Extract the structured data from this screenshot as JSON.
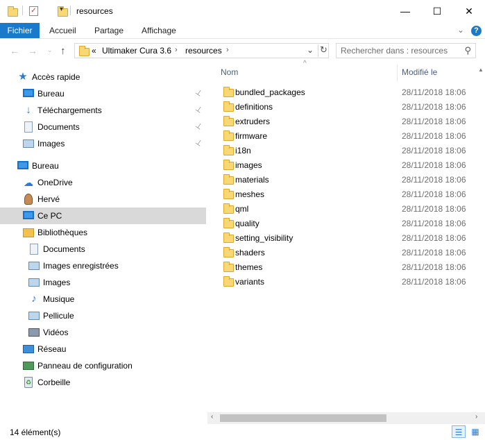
{
  "window": {
    "title": "resources",
    "minimize_glyph": "—",
    "maximize_glyph": "☐",
    "close_glyph": "✕"
  },
  "ribbon": {
    "tabs": [
      "Fichier",
      "Accueil",
      "Partage",
      "Affichage"
    ],
    "help_glyph": "?",
    "collapse_glyph": "⌄"
  },
  "address": {
    "overflow": "«",
    "segments": [
      "Ultimaker Cura 3.6",
      "resources"
    ],
    "separator": "›",
    "dropdown_glyph": "⌄",
    "refresh_glyph": "↻"
  },
  "search": {
    "placeholder": "Rechercher dans : resources",
    "icon": "search-icon"
  },
  "nav": {
    "items": [
      {
        "label": "Accès rapide",
        "icon": "star-icon",
        "indent": 0,
        "pinned": false,
        "selected": false
      },
      {
        "label": "Bureau",
        "icon": "desktop-icon",
        "indent": 1,
        "pinned": true,
        "selected": false
      },
      {
        "label": "Téléchargements",
        "icon": "download-icon",
        "indent": 1,
        "pinned": true,
        "selected": false
      },
      {
        "label": "Documents",
        "icon": "document-icon",
        "indent": 1,
        "pinned": true,
        "selected": false
      },
      {
        "label": "Images",
        "icon": "pictures-icon",
        "indent": 1,
        "pinned": true,
        "selected": false
      },
      {
        "label": "Bureau",
        "icon": "desktop-icon",
        "indent": 0,
        "pinned": false,
        "selected": false
      },
      {
        "label": "OneDrive",
        "icon": "cloud-icon",
        "indent": 1,
        "pinned": false,
        "selected": false
      },
      {
        "label": "Hervé",
        "icon": "user-icon",
        "indent": 1,
        "pinned": false,
        "selected": false
      },
      {
        "label": "Ce PC",
        "icon": "computer-icon",
        "indent": 1,
        "pinned": false,
        "selected": true
      },
      {
        "label": "Bibliothèques",
        "icon": "libraries-icon",
        "indent": 1,
        "pinned": false,
        "selected": false
      },
      {
        "label": "Documents",
        "icon": "document-icon",
        "indent": 2,
        "pinned": false,
        "selected": false
      },
      {
        "label": "Images enregistrées",
        "icon": "pictures-icon",
        "indent": 2,
        "pinned": false,
        "selected": false
      },
      {
        "label": "Images",
        "icon": "pictures-icon",
        "indent": 2,
        "pinned": false,
        "selected": false
      },
      {
        "label": "Musique",
        "icon": "music-icon",
        "indent": 2,
        "pinned": false,
        "selected": false
      },
      {
        "label": "Pellicule",
        "icon": "pictures-icon",
        "indent": 2,
        "pinned": false,
        "selected": false
      },
      {
        "label": "Vidéos",
        "icon": "video-icon",
        "indent": 2,
        "pinned": false,
        "selected": false
      },
      {
        "label": "Réseau",
        "icon": "network-icon",
        "indent": 1,
        "pinned": false,
        "selected": false
      },
      {
        "label": "Panneau de configuration",
        "icon": "control-panel-icon",
        "indent": 1,
        "pinned": false,
        "selected": false
      },
      {
        "label": "Corbeille",
        "icon": "recycle-bin-icon",
        "indent": 1,
        "pinned": false,
        "selected": false
      }
    ],
    "pin_glyph": "📌"
  },
  "columns": {
    "name": "Nom",
    "modified": "Modifié le",
    "sort_glyph": "^"
  },
  "files": [
    {
      "name": "bundled_packages",
      "modified": "28/11/2018 18:06"
    },
    {
      "name": "definitions",
      "modified": "28/11/2018 18:06"
    },
    {
      "name": "extruders",
      "modified": "28/11/2018 18:06"
    },
    {
      "name": "firmware",
      "modified": "28/11/2018 18:06"
    },
    {
      "name": "i18n",
      "modified": "28/11/2018 18:06"
    },
    {
      "name": "images",
      "modified": "28/11/2018 18:06"
    },
    {
      "name": "materials",
      "modified": "28/11/2018 18:06"
    },
    {
      "name": "meshes",
      "modified": "28/11/2018 18:06"
    },
    {
      "name": "qml",
      "modified": "28/11/2018 18:06"
    },
    {
      "name": "quality",
      "modified": "28/11/2018 18:06"
    },
    {
      "name": "setting_visibility",
      "modified": "28/11/2018 18:06"
    },
    {
      "name": "shaders",
      "modified": "28/11/2018 18:06"
    },
    {
      "name": "themes",
      "modified": "28/11/2018 18:06"
    },
    {
      "name": "variants",
      "modified": "28/11/2018 18:06"
    }
  ],
  "status": {
    "count": "14 élément(s)"
  },
  "colors": {
    "accent": "#1979ca",
    "selection": "#d9d9d9",
    "folder": "#f8d775"
  }
}
